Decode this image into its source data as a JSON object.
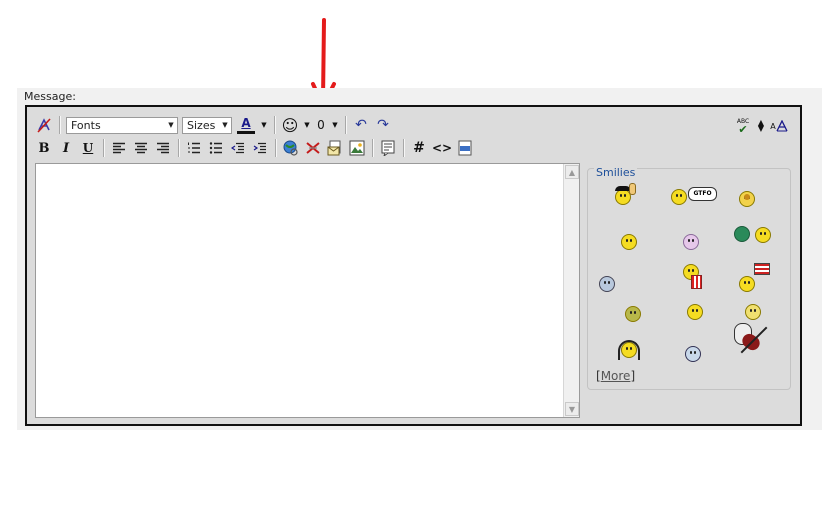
{
  "form": {
    "label": "Message:"
  },
  "toolbar": {
    "font_select": "Fonts",
    "size_select": "Sizes",
    "text_color_label": "A",
    "bold": "B",
    "italic": "I",
    "underline": "U",
    "code_hash": "#",
    "code_tag": "<>",
    "spell_label": "ABC",
    "fontsize_label": "A"
  },
  "smilies": {
    "title": "Smilies",
    "more_prefix": "[",
    "more_link": "More",
    "more_suffix": "]",
    "items": [
      {
        "name": "rocker-smiley-icon"
      },
      {
        "name": "gtfo-smiley-icon",
        "bubble": "GTFO"
      },
      {
        "name": "badge-smiley-icon"
      },
      {
        "name": "grin-smiley-icon"
      },
      {
        "name": "purple-smiley-icon"
      },
      {
        "name": "globe-smiley-icon"
      },
      {
        "name": "popcorn-smiley-icon"
      },
      {
        "name": "flag-smiley-icon"
      },
      {
        "name": "dizzy-smiley-icon"
      },
      {
        "name": "sick-smiley-icon"
      },
      {
        "name": "surprised-smiley-icon"
      },
      {
        "name": "smile-smiley-icon"
      },
      {
        "name": "headphones-smiley-icon"
      },
      {
        "name": "shocked-smiley-icon"
      },
      {
        "name": "violin-smiley-icon"
      }
    ]
  },
  "colors": {
    "annotation_arrow": "#e41b1b",
    "link": "#1d4f9a"
  }
}
